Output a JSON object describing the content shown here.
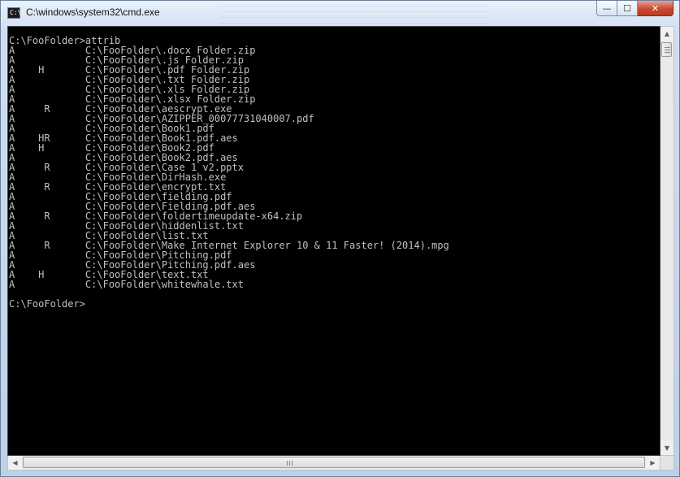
{
  "window": {
    "title": "C:\\windows\\system32\\cmd.exe",
    "icon_text": "C:\\",
    "minimize_glyph": "—",
    "maximize_glyph": "☐",
    "close_glyph": "✕"
  },
  "console": {
    "lines": [
      "C:\\FooFolder>attrib",
      "A            C:\\FooFolder\\.docx Folder.zip",
      "A            C:\\FooFolder\\.js Folder.zip",
      "A    H       C:\\FooFolder\\.pdf Folder.zip",
      "A            C:\\FooFolder\\.txt Folder.zip",
      "A            C:\\FooFolder\\.xls Folder.zip",
      "A            C:\\FooFolder\\.xlsx Folder.zip",
      "A     R      C:\\FooFolder\\aescrypt.exe",
      "A            C:\\FooFolder\\AZIPPER_00077731040007.pdf",
      "A            C:\\FooFolder\\Book1.pdf",
      "A    HR      C:\\FooFolder\\Book1.pdf.aes",
      "A    H       C:\\FooFolder\\Book2.pdf",
      "A            C:\\FooFolder\\Book2.pdf.aes",
      "A     R      C:\\FooFolder\\Case 1 v2.pptx",
      "A            C:\\FooFolder\\DirHash.exe",
      "A     R      C:\\FooFolder\\encrypt.txt",
      "A            C:\\FooFolder\\fielding.pdf",
      "A            C:\\FooFolder\\Fielding.pdf.aes",
      "A     R      C:\\FooFolder\\foldertimeupdate-x64.zip",
      "A            C:\\FooFolder\\hiddenlist.txt",
      "A            C:\\FooFolder\\list.txt",
      "A     R      C:\\FooFolder\\Make Internet Explorer 10 & 11 Faster! (2014).mpg",
      "A            C:\\FooFolder\\Pitching.pdf",
      "A            C:\\FooFolder\\Pitching.pdf.aes",
      "A    H       C:\\FooFolder\\text.txt",
      "A            C:\\FooFolder\\whitewhale.txt",
      "",
      "C:\\FooFolder>"
    ]
  },
  "scrollbars": {
    "up_arrow": "▲",
    "down_arrow": "▼",
    "left_arrow": "◀",
    "right_arrow": "▶"
  },
  "colors": {
    "console_bg": "#000000",
    "console_fg": "#c0c0c0",
    "close_button": "#c84a32"
  }
}
